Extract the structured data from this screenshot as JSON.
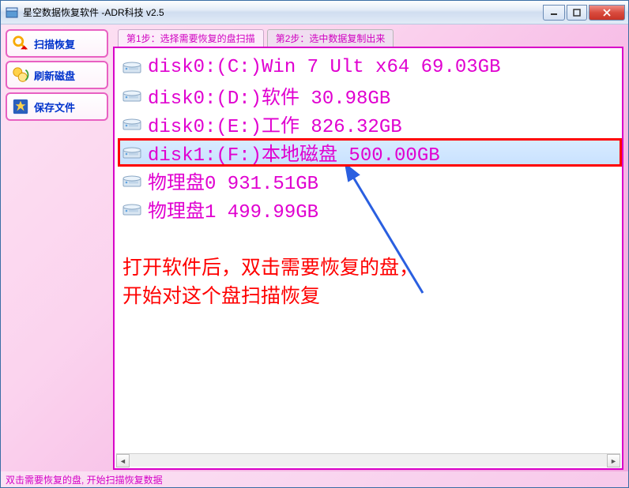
{
  "window": {
    "title": "星空数据恢复软件   -ADR科技 v2.5"
  },
  "sidebar": {
    "scan": "扫描恢复",
    "refresh": "刷新磁盘",
    "save": "保存文件"
  },
  "tabs": {
    "step1": "第1步：选择需要恢复的盘扫描",
    "step2": "第2步：选中数据复制出来"
  },
  "disks": [
    {
      "text": "disk0:(C:)Win 7 Ult x64 69.03GB",
      "selected": false,
      "highlight": false
    },
    {
      "text": "disk0:(D:)软件 30.98GB",
      "selected": false,
      "highlight": false
    },
    {
      "text": "disk0:(E:)工作 826.32GB",
      "selected": false,
      "highlight": false
    },
    {
      "text": "disk1:(F:)本地磁盘 500.00GB",
      "selected": true,
      "highlight": true
    },
    {
      "text": "物理盘0 931.51GB",
      "selected": false,
      "highlight": false
    },
    {
      "text": "物理盘1 499.99GB",
      "selected": false,
      "highlight": false
    }
  ],
  "annotation": {
    "line1": "打开软件后，双击需要恢复的盘，",
    "line2": "开始对这个盘扫描恢复"
  },
  "statusbar": "双击需要恢复的盘, 开始扫描恢复数据"
}
